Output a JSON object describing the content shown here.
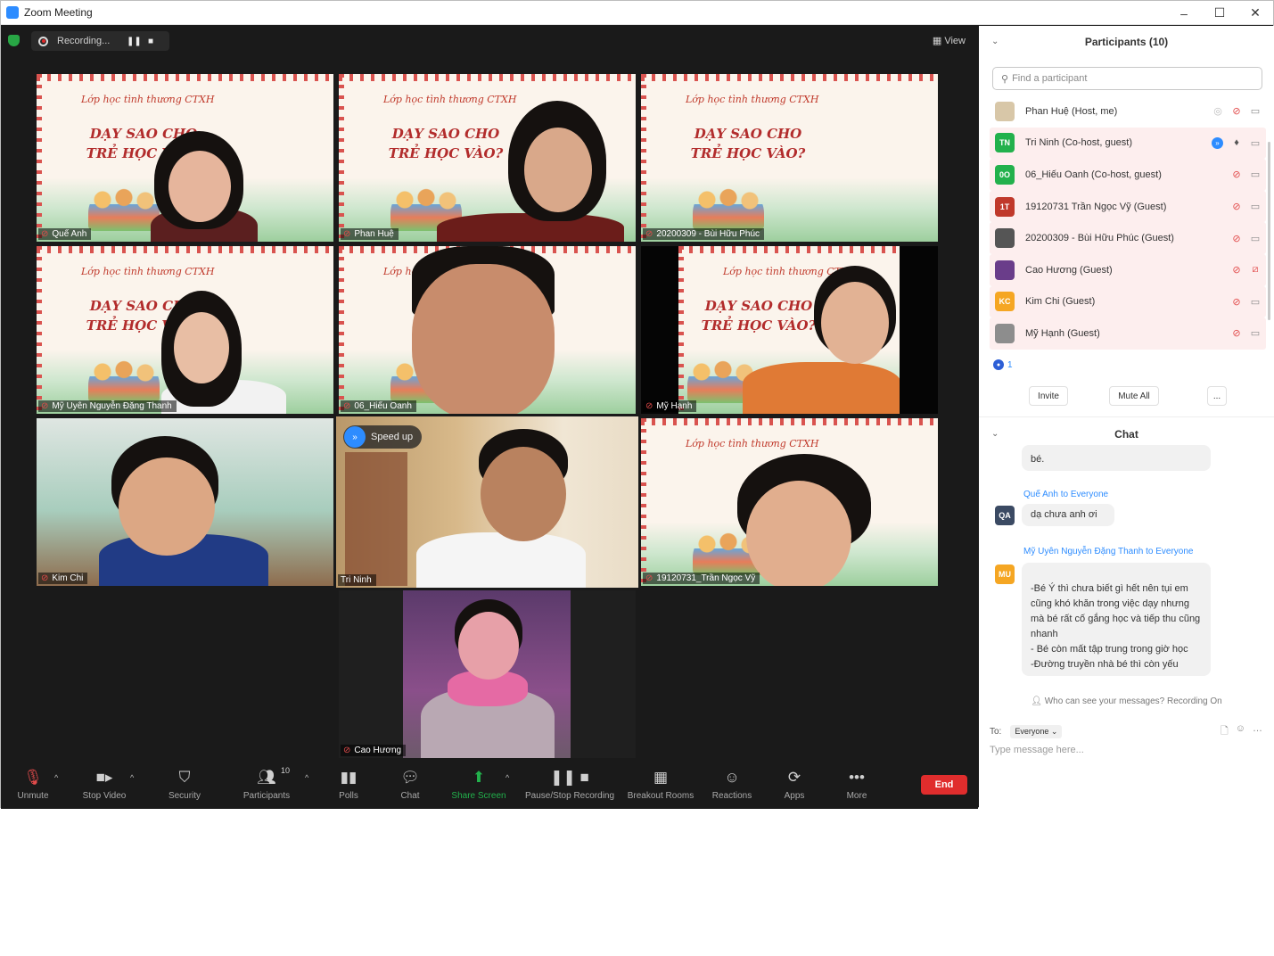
{
  "window": {
    "title": "Zoom Meeting",
    "controls": [
      "–",
      "☐",
      "✕"
    ]
  },
  "recording": {
    "label": "Recording...",
    "pause_glyph": "❚❚",
    "stop_glyph": "■"
  },
  "view_label": "View",
  "slide": {
    "subtitle": "Lớp học tình thương CTXH",
    "title": "DẠY SAO CHO TRẺ HỌC VÀO?"
  },
  "tiles": [
    {
      "name": "Quế Anh"
    },
    {
      "name": "Phan Huệ"
    },
    {
      "name": "20200309 - Bùi Hữu Phúc"
    },
    {
      "name": "Mỹ Uyên Nguyễn Đặng Thanh"
    },
    {
      "name": "06_Hiếu Oanh"
    },
    {
      "name": "Mỹ Hạnh"
    },
    {
      "name": "Kim Chi"
    },
    {
      "name": "Tri Ninh",
      "badge": "Speed up"
    },
    {
      "name": "19120731_Trần Ngọc Vỹ"
    },
    {
      "name": "Cao Hương"
    }
  ],
  "toolbar": {
    "unmute": "Unmute",
    "stop_video": "Stop Video",
    "security": "Security",
    "participants": "Participants",
    "participants_count": "10",
    "polls": "Polls",
    "chat": "Chat",
    "share_screen": "Share Screen",
    "pause_stop_recording": "Pause/Stop Recording",
    "breakout_rooms": "Breakout Rooms",
    "reactions": "Reactions",
    "apps": "Apps",
    "more": "More",
    "end": "End"
  },
  "participants_panel": {
    "title": "Participants (10)",
    "search_placeholder": "Find a participant",
    "items": [
      {
        "initials": "",
        "label": "Phan Huệ (Host, me)",
        "avatar_color": "#d8c7a8"
      },
      {
        "initials": "TN",
        "label": "Tri Ninh (Co-host, guest)",
        "avatar_color": "#22b14c"
      },
      {
        "initials": "0O",
        "label": "06_Hiếu Oanh (Co-host, guest)",
        "avatar_color": "#22b14c"
      },
      {
        "initials": "1T",
        "label": "19120731 Trần Ngọc Vỹ (Guest)",
        "avatar_color": "#c0392b"
      },
      {
        "initials": "",
        "label": "20200309 - Bùi Hữu Phúc (Guest)",
        "avatar_color": "#555555"
      },
      {
        "initials": "",
        "label": "Cao Hương (Guest)",
        "avatar_color": "#6a3d8a"
      },
      {
        "initials": "KC",
        "label": "Kim Chi (Guest)",
        "avatar_color": "#f5a623"
      },
      {
        "initials": "",
        "label": "Mỹ Hạnh (Guest)",
        "avatar_color": "#8d8d8d"
      }
    ],
    "waiting_count": "1",
    "invite": "Invite",
    "mute_all": "Mute All",
    "more": "..."
  },
  "chat_panel": {
    "title": "Chat",
    "partial_text": "bé.",
    "messages": [
      {
        "sender": "Quế Anh to Everyone",
        "initials": "QA",
        "avatar_color": "#3b4a63",
        "text": "dạ chưa anh ơi"
      },
      {
        "sender": "Mỹ Uyên Nguyễn Đặng Thanh to Everyone",
        "initials": "MU",
        "avatar_color": "#f5a623",
        "text": "-Bé Ý thì chưa biết gì hết nên tụi em cũng khó khăn trong việc dạy nhưng mà bé rất cố gắng học và tiếp thu cũng nhanh\n- Bé còn mất tập trung trong giờ học\n-Đường truyền nhà bé thì còn yếu"
      }
    ],
    "privacy_note": "Who can see your messages? Recording On",
    "to_label": "To:",
    "to_value": "Everyone",
    "input_placeholder": "Type message here..."
  }
}
